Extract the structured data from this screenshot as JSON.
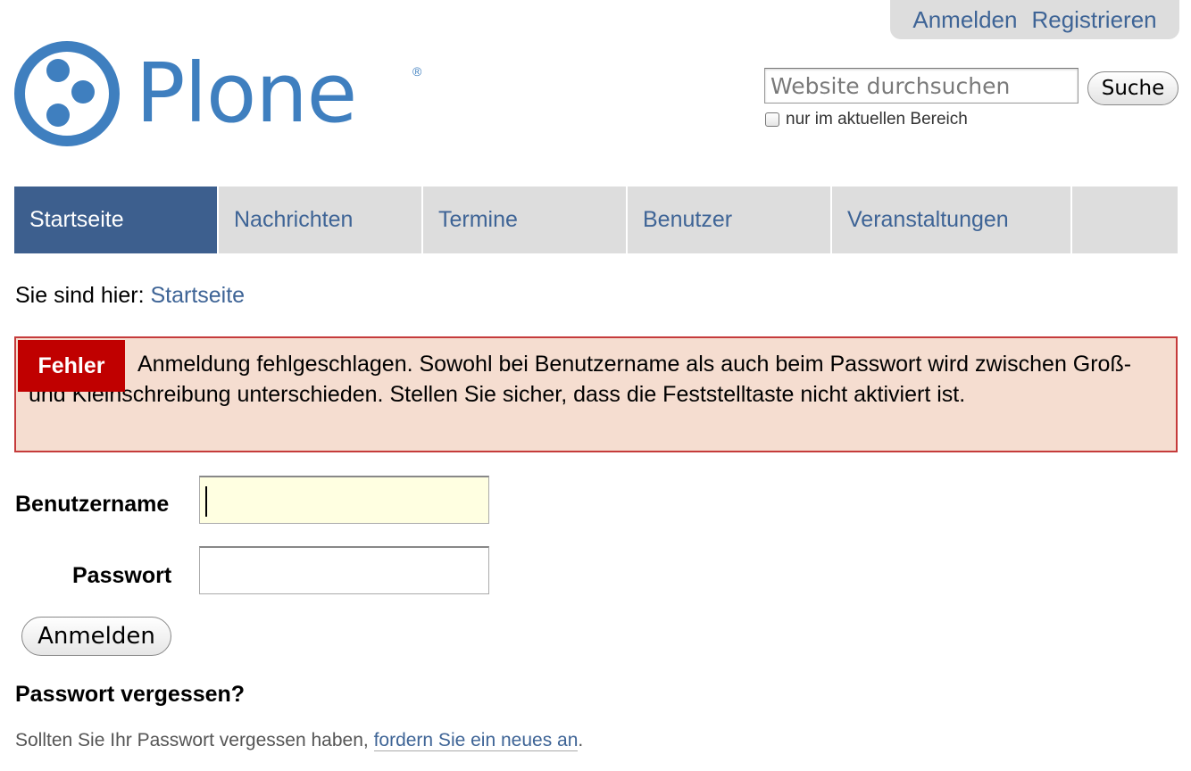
{
  "personal_bar": {
    "login": "Anmelden",
    "register": "Registrieren"
  },
  "logo": {
    "text": "Plone",
    "registered": "®"
  },
  "search": {
    "placeholder": "Website durchsuchen",
    "button": "Suche",
    "scope_label": "nur im aktuellen Bereich"
  },
  "nav": {
    "tabs": [
      {
        "label": "Startseite",
        "active": true
      },
      {
        "label": "Nachrichten",
        "active": false
      },
      {
        "label": "Termine",
        "active": false
      },
      {
        "label": "Benutzer",
        "active": false
      },
      {
        "label": "Veranstaltungen",
        "active": false
      }
    ]
  },
  "breadcrumb": {
    "prefix": "Sie sind hier:",
    "home": "Startseite"
  },
  "error": {
    "label": "Fehler",
    "message": "Anmeldung fehlgeschlagen. Sowohl bei Benutzername als auch beim Passwort wird zwischen Groß- und Kleinschreibung unterschieden. Stellen Sie sicher, dass die Feststelltaste nicht aktiviert ist."
  },
  "login": {
    "username_label": "Benutzername",
    "username_value": "",
    "password_label": "Passwort",
    "password_value": "",
    "submit": "Anmelden"
  },
  "forgot": {
    "title": "Passwort vergessen?",
    "text": "Sollten Sie Ihr Passwort vergessen haben,",
    "link": "fordern Sie ein neues an",
    "suffix": "."
  },
  "colors": {
    "nav_active": "#3d5f8e",
    "link": "#3e6496",
    "error_label": "#c00000",
    "error_bg": "#f5ddd0",
    "logo": "#3f7fbf"
  }
}
